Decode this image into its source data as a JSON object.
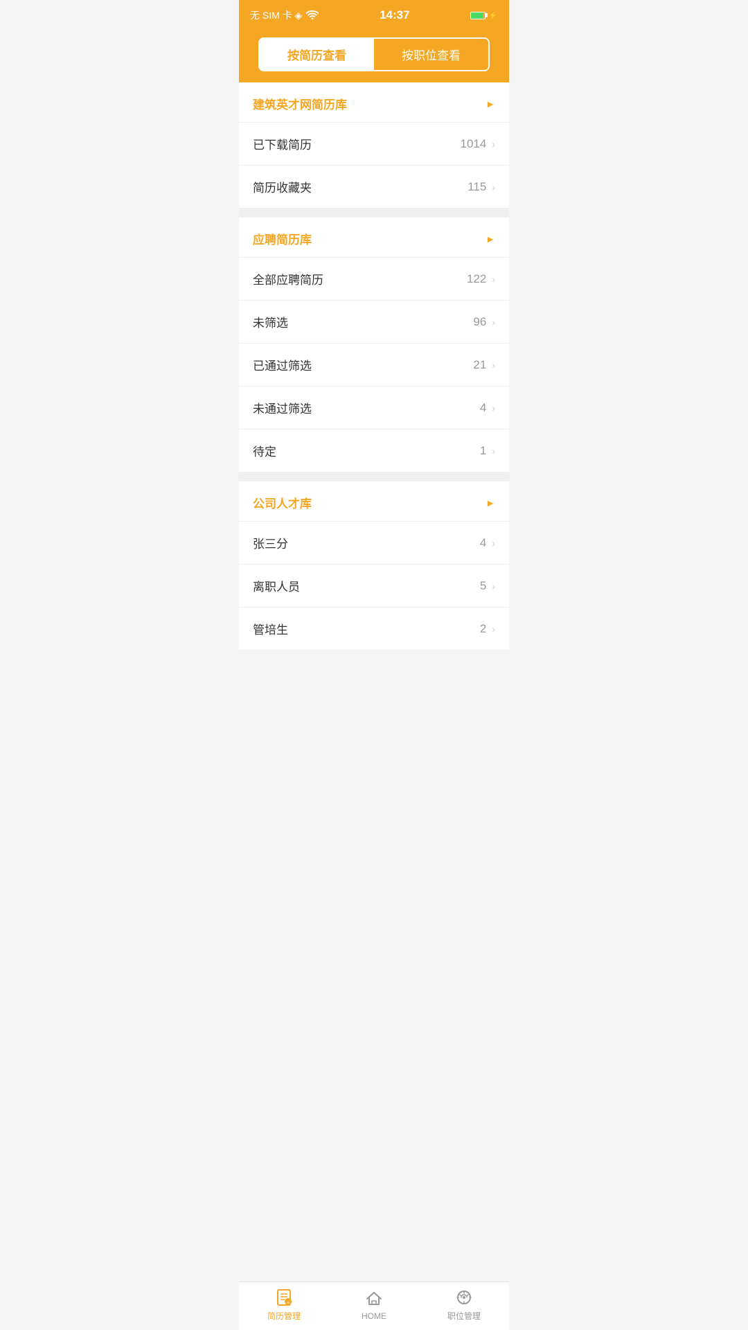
{
  "statusBar": {
    "left": "无 SIM 卡 ◈",
    "time": "14:37",
    "wifi": "⌾",
    "battery": "85"
  },
  "topTabs": {
    "tab1": {
      "label": "按简历查看",
      "active": true
    },
    "tab2": {
      "label": "按职位查看",
      "active": false
    }
  },
  "sections": [
    {
      "id": "jianzhuyingcai",
      "title": "建筑英才网简历库",
      "items": [
        {
          "label": "已下载简历",
          "count": "1014"
        },
        {
          "label": "简历收藏夹",
          "count": "115"
        }
      ]
    },
    {
      "id": "yingpinjianliku",
      "title": "应聘简历库",
      "items": [
        {
          "label": "全部应聘简历",
          "count": "122"
        },
        {
          "label": "未筛选",
          "count": "96"
        },
        {
          "label": "已通过筛选",
          "count": "21"
        },
        {
          "label": "未通过筛选",
          "count": "4"
        },
        {
          "label": "待定",
          "count": "1"
        }
      ]
    },
    {
      "id": "gongsirencaiku",
      "title": "公司人才库",
      "items": [
        {
          "label": "张三分",
          "count": "4"
        },
        {
          "label": "离职人员",
          "count": "5"
        },
        {
          "label": "管培生",
          "count": "2"
        }
      ]
    }
  ],
  "bottomTabs": [
    {
      "label": "简历管理",
      "active": true,
      "icon": "resume-icon"
    },
    {
      "label": "HOME",
      "active": false,
      "icon": "home-icon"
    },
    {
      "label": "职位管理",
      "active": false,
      "icon": "jobs-icon"
    }
  ]
}
